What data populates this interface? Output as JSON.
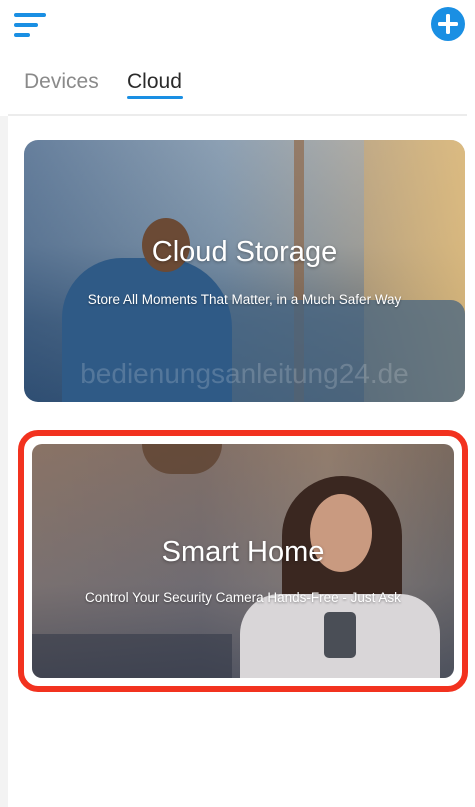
{
  "header": {
    "menu_icon": "hamburger-menu-icon",
    "add_icon": "plus-circle-icon",
    "accent_color": "#1a8fe3"
  },
  "tabs": [
    {
      "label": "Devices",
      "active": false
    },
    {
      "label": "Cloud",
      "active": true
    }
  ],
  "cards": [
    {
      "title": "Cloud Storage",
      "subtitle": "Store All Moments That Matter, in a Much Safer Way",
      "watermark": "bedienungsanleitung24.de"
    },
    {
      "title": "Smart Home",
      "subtitle": "Control Your Security Camera Hands-Free - Just Ask",
      "highlight_color": "#f2321f"
    }
  ]
}
